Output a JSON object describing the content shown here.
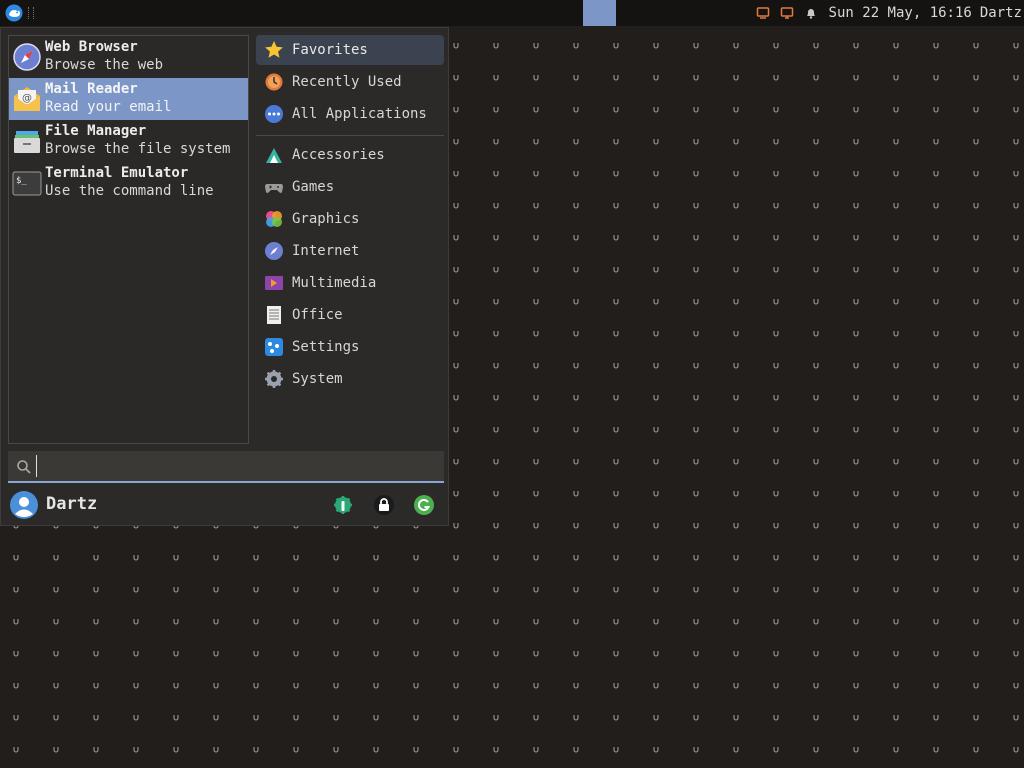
{
  "panel": {
    "clock": "Sun 22 May, 16:16",
    "user": "Dartz",
    "tray_icons": [
      "network-icon",
      "display-icon",
      "notification-bell-icon"
    ],
    "workspace_color": "#7c97c7"
  },
  "menu": {
    "favorites": [
      {
        "name": "Web Browser",
        "desc": "Browse the web",
        "icon": "web-browser-icon"
      },
      {
        "name": "Mail Reader",
        "desc": "Read your email",
        "icon": "mail-reader-icon",
        "selected": true
      },
      {
        "name": "File Manager",
        "desc": "Browse the file system",
        "icon": "file-manager-icon"
      },
      {
        "name": "Terminal Emulator",
        "desc": "Use the command line",
        "icon": "terminal-icon"
      }
    ],
    "categories_top": [
      {
        "label": "Favorites",
        "icon": "star-icon",
        "active": true
      },
      {
        "label": "Recently Used",
        "icon": "recent-icon"
      },
      {
        "label": "All Applications",
        "icon": "all-apps-icon"
      }
    ],
    "categories": [
      {
        "label": "Accessories",
        "icon": "accessories-icon"
      },
      {
        "label": "Games",
        "icon": "games-icon"
      },
      {
        "label": "Graphics",
        "icon": "graphics-icon"
      },
      {
        "label": "Internet",
        "icon": "internet-icon"
      },
      {
        "label": "Multimedia",
        "icon": "multimedia-icon"
      },
      {
        "label": "Office",
        "icon": "office-icon"
      },
      {
        "label": "Settings",
        "icon": "settings-icon"
      },
      {
        "label": "System",
        "icon": "system-icon"
      }
    ],
    "search": {
      "value": "",
      "placeholder": ""
    },
    "username": "Dartz",
    "actions": [
      "settings-manager-icon",
      "lock-screen-icon",
      "logout-icon"
    ],
    "accent_color": "#8aa6d6"
  }
}
